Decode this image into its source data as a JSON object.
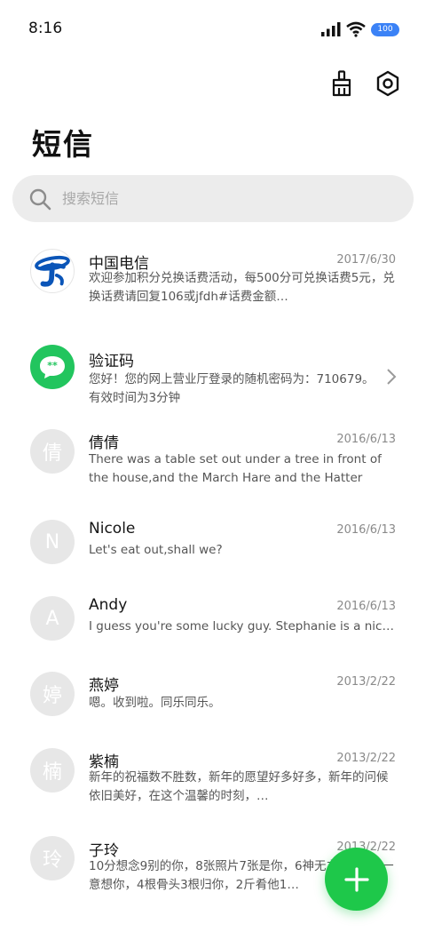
{
  "status_bar": {
    "time": "8:16",
    "battery": "100"
  },
  "page_title": "短信",
  "search": {
    "placeholder": "搜索短信"
  },
  "colors": {
    "fab": "#1ec84a",
    "telecom_logo": "#0a55b8",
    "verification_icon": "#22c55e",
    "search_bg": "#ececec"
  },
  "messages": [
    {
      "name": "中国电信",
      "date": "2017/6/30",
      "avatar_icon": "china-telecom-logo",
      "preview": "欢迎参加积分兑换话费活动，每500分可兑换话费5元，兑换话费请回复106或jfdh#话费金额…"
    },
    {
      "name": "验证码",
      "date": "",
      "avatar_icon": "chat-bubble-icon",
      "preview": "您好！您的网上营业厅登录的随机密码为：710679。有效时间为3分钟"
    },
    {
      "name": "倩倩",
      "date": "2016/6/13",
      "avatar": "倩",
      "preview": "There was a table set out under a tree in front of the house,and the March Hare and the Hatter were…"
    },
    {
      "name": "Nicole",
      "date": "2016/6/13",
      "avatar": "N",
      "preview": "Let's eat out,shall we?"
    },
    {
      "name": "Andy",
      "date": "2016/6/13",
      "avatar": "A",
      "preview": "I guess you're some lucky guy. Stephanie is a nice girl."
    },
    {
      "name": "燕婷",
      "date": "2013/2/22",
      "avatar": "婷",
      "preview": "嗯。收到啦。同乐同乐。"
    },
    {
      "name": "紫楠",
      "date": "2013/2/22",
      "avatar": "楠",
      "preview": "新年的祝福数不胜数，新年的愿望好多好多，新年的问候依旧美好，在这个温馨的时刻，…"
    },
    {
      "name": "子玲",
      "date": "2013/2/22",
      "avatar": "玲",
      "preview": "10分想念9别的你，8张照片7张是你，6神无主你，5心一意想你，4根骨头3根归你，2斤肴他1…"
    }
  ]
}
